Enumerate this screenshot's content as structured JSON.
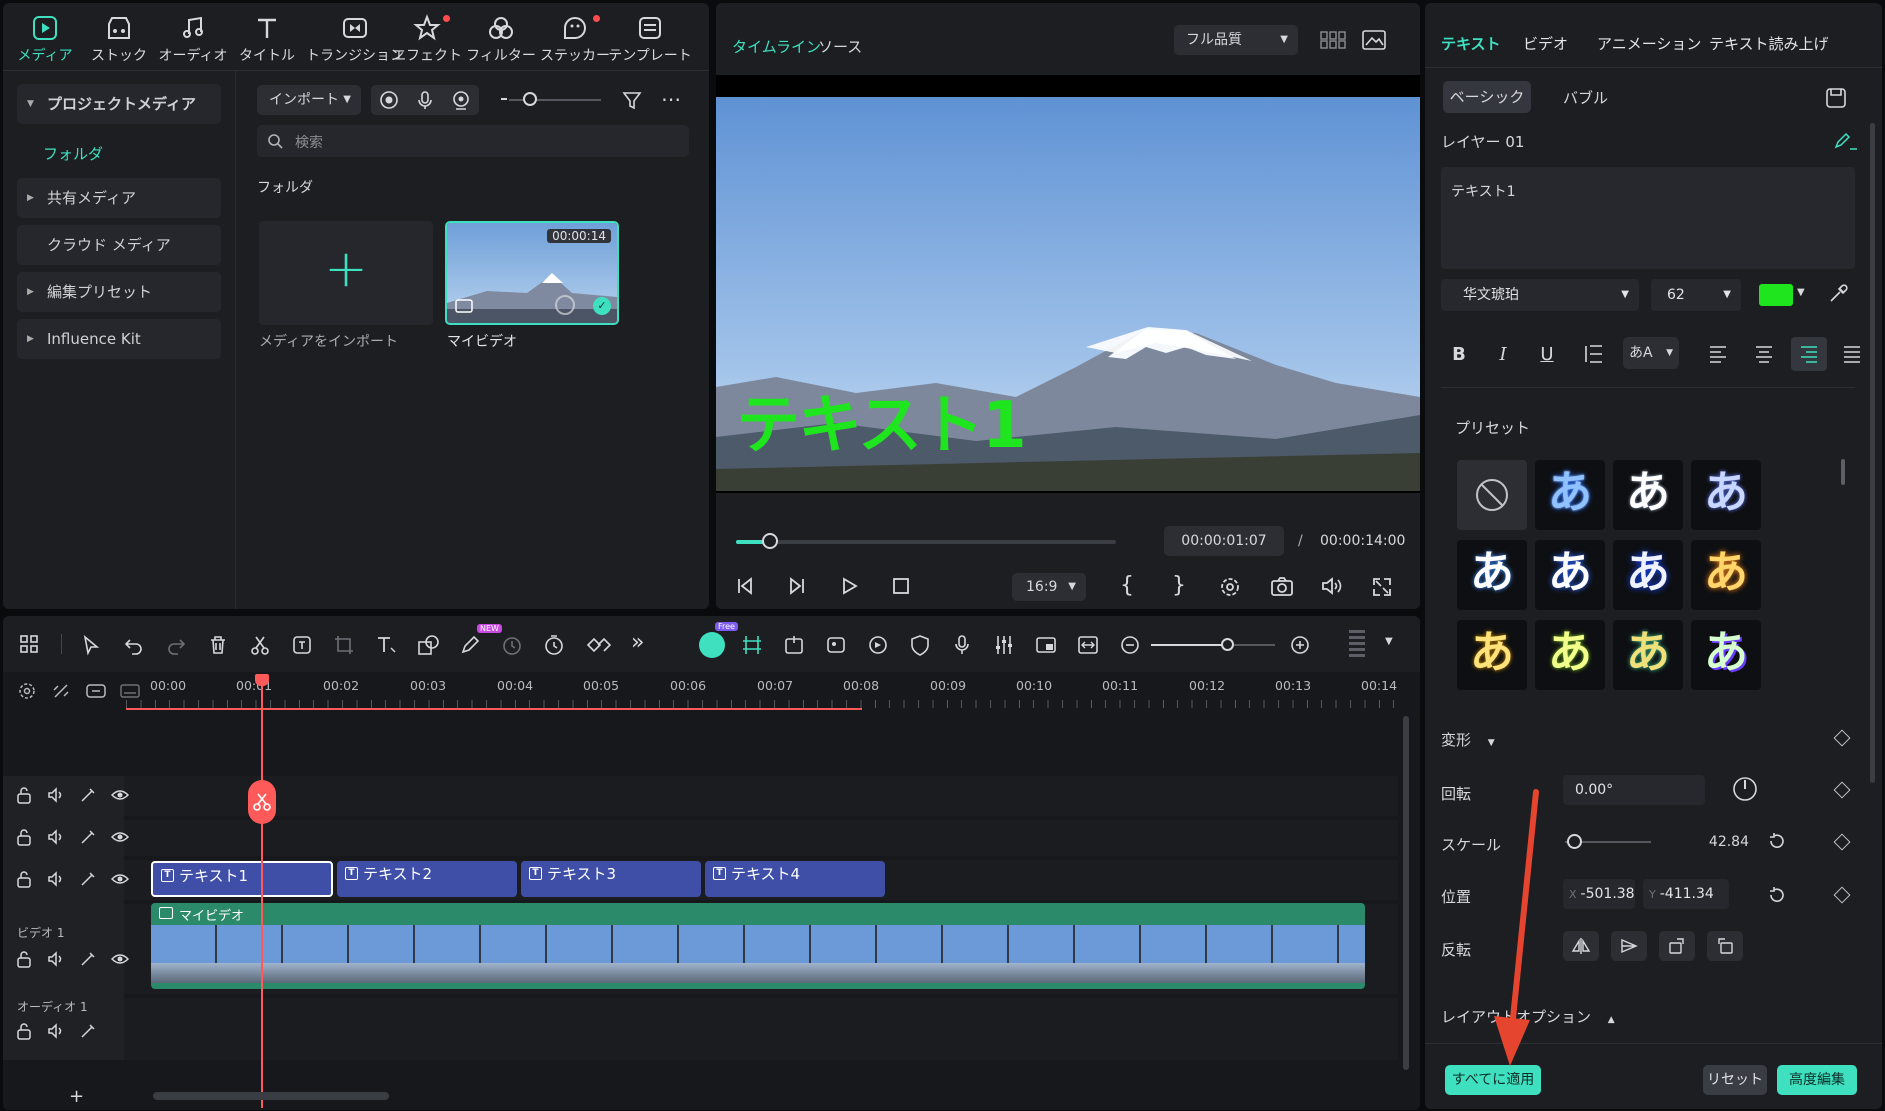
{
  "toolbar": {
    "items": [
      {
        "label": "メディア",
        "icon": "media-icon",
        "active": true
      },
      {
        "label": "ストック",
        "icon": "stock-icon"
      },
      {
        "label": "オーディオ",
        "icon": "audio-note-icon"
      },
      {
        "label": "タイトル",
        "icon": "title-t-icon"
      },
      {
        "label": "トランジション",
        "icon": "transition-icon"
      },
      {
        "label": "エフェクト",
        "icon": "effect-star-icon",
        "badge": true
      },
      {
        "label": "フィルター",
        "icon": "filter-icon"
      },
      {
        "label": "ステッカー",
        "icon": "sticker-icon",
        "badge": true
      },
      {
        "label": "テンプレート",
        "icon": "template-icon"
      }
    ]
  },
  "sidebar": {
    "items": [
      {
        "label": "プロジェクトメディア",
        "expanded": true
      },
      {
        "label": "フォルダ",
        "active": true
      },
      {
        "label": "共有メディア"
      },
      {
        "label": "クラウド メディア"
      },
      {
        "label": "編集プリセット"
      },
      {
        "label": "Influence Kit"
      }
    ]
  },
  "media": {
    "import_label": "インポート",
    "search_placeholder": "検索",
    "folder_title": "フォルダ",
    "import_tile_label": "メディアをインポート",
    "clip_name": "マイビデオ",
    "clip_duration": "00:00:14"
  },
  "preview": {
    "tab_timeline": "タイムライン",
    "tab_source": "ソース",
    "quality": "フル品質",
    "overlay_text": "テキスト1",
    "current_time": "00:00:01:07",
    "separator": "/",
    "total_time": "00:00:14:00",
    "aspect": "16:9",
    "progress": 0.09
  },
  "timeline": {
    "ruler": [
      "00:00",
      "00:01",
      "00:02",
      "00:03",
      "00:04",
      "00:05",
      "00:06",
      "00:07",
      "00:08",
      "00:09",
      "00:10",
      "00:11",
      "00:12",
      "00:13",
      "00:14"
    ],
    "ai_badge": "NEW",
    "free_badge": "Free",
    "text_clips": [
      "テキスト1",
      "テキスト2",
      "テキスト3",
      "テキスト4"
    ],
    "video_track_label": "ビデオ 1",
    "audio_track_label": "オーディオ 1",
    "video_clip_label": "マイビデオ",
    "add_track": "+"
  },
  "inspector": {
    "tabs": [
      "テキスト",
      "ビデオ",
      "アニメーション",
      "テキスト読み上げ"
    ],
    "subtabs": [
      "ベーシック",
      "バブル"
    ],
    "layer": "レイヤー 01",
    "text_value": "テキスト1",
    "font": "华文琥珀",
    "size": "62",
    "color": "#1fe51f",
    "format_buttons": [
      "B",
      "I",
      "U"
    ],
    "case_button": "あA",
    "preset_title": "プリセット",
    "preset_glyph": "あ",
    "transform_title": "変形",
    "rotate_label": "回転",
    "rotate_value": "0.00°",
    "scale_label": "スケール",
    "scale_value": "42.84",
    "scale_level": 0.1,
    "position_label": "位置",
    "pos_x_label": "X",
    "pos_x": "-501.38",
    "pos_y_label": "Y",
    "pos_y": "-411.34",
    "flip_label": "反転",
    "layout_title": "レイアウトオプション",
    "apply_all": "すべてに適用",
    "reset": "リセット",
    "advanced": "高度編集"
  },
  "colors": {
    "accent": "#3ee0c0",
    "playhead": "#ff5a5a",
    "text_clip": "#3f4fa8",
    "video_clip": "#2a8a6a",
    "annotation_arrow": "#e5452f"
  }
}
